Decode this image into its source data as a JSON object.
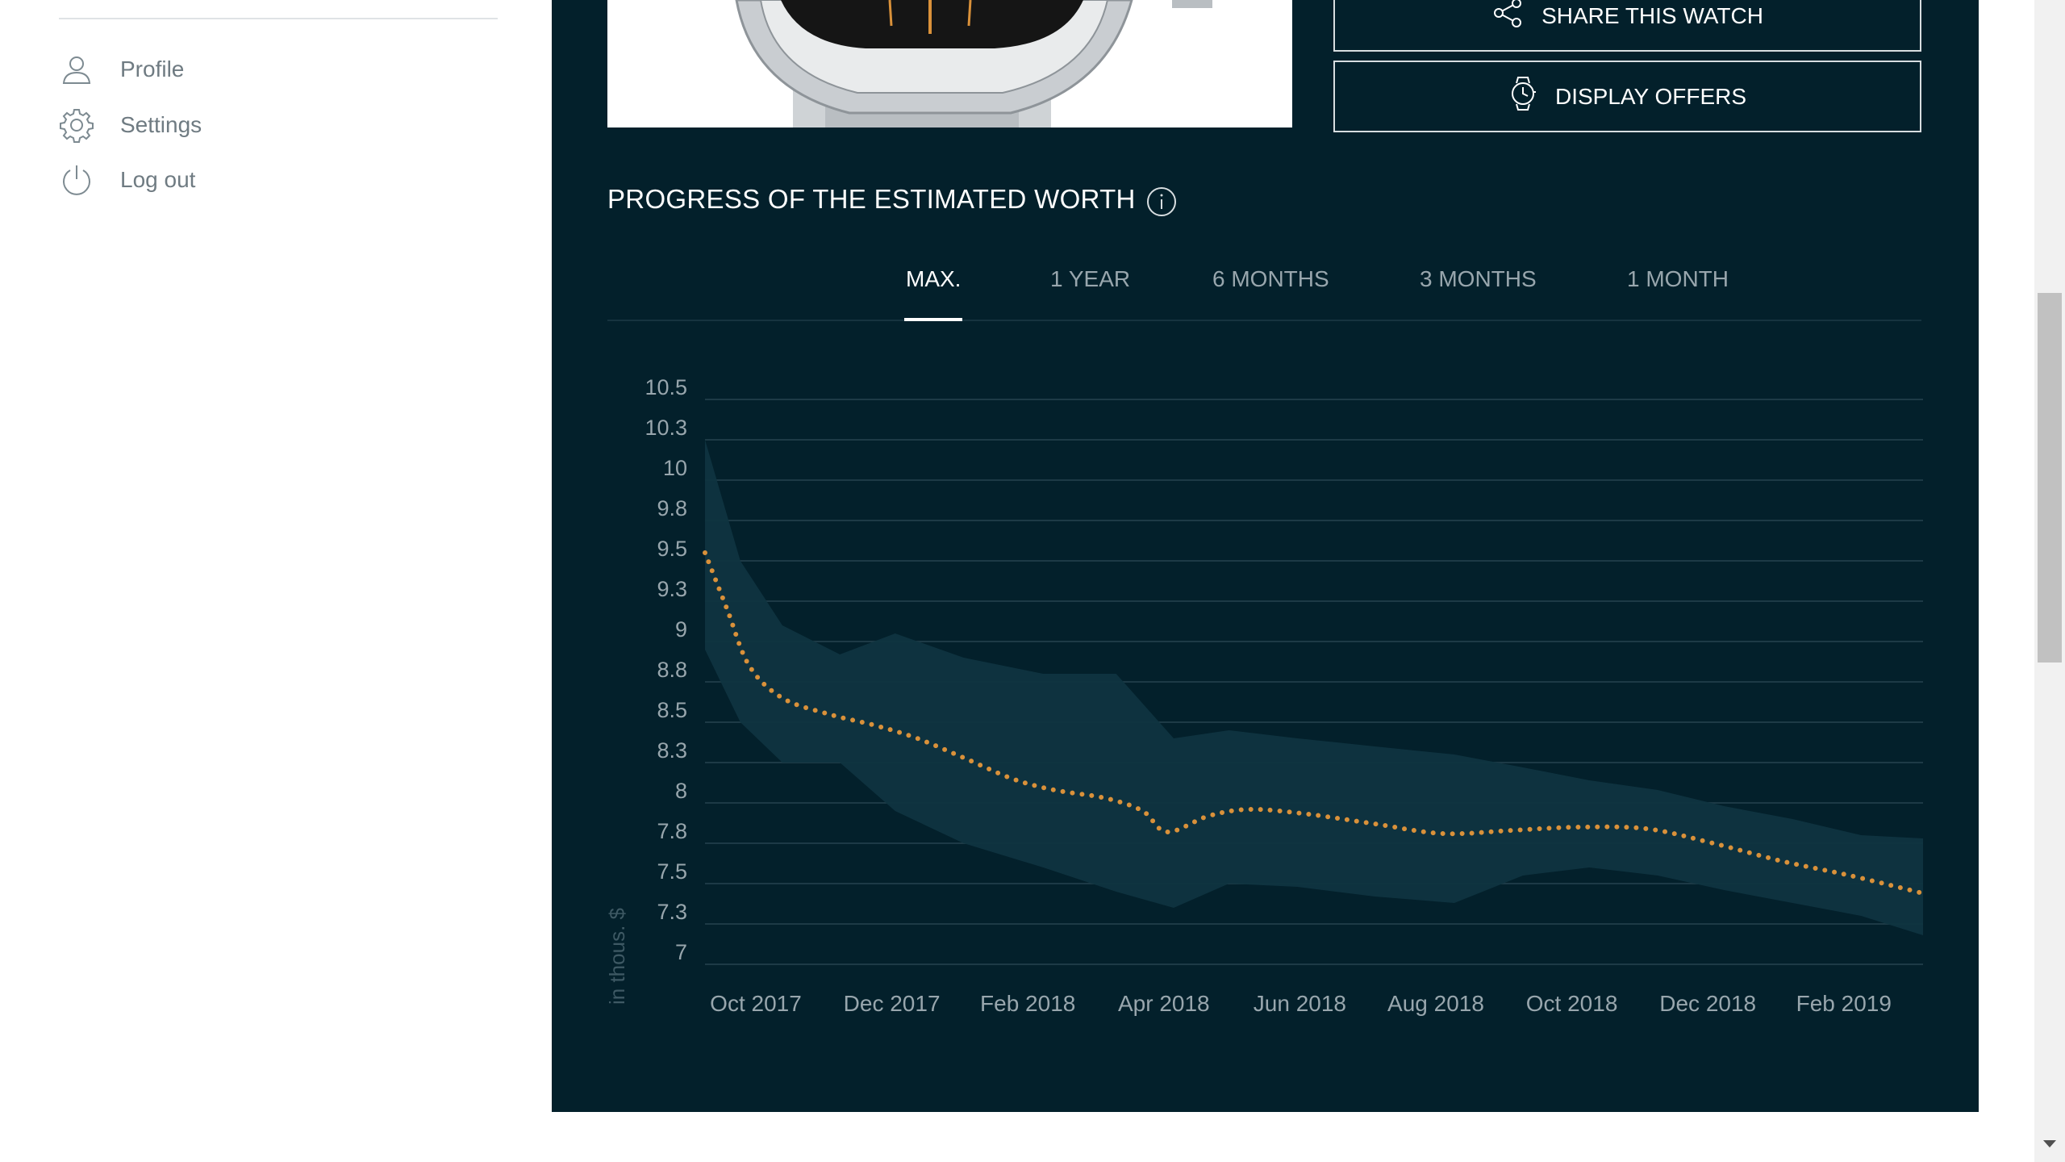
{
  "sidebar": {
    "items": [
      {
        "label": "Profile",
        "icon": "user-icon"
      },
      {
        "label": "Settings",
        "icon": "gear-icon"
      },
      {
        "label": "Log out",
        "icon": "power-icon"
      }
    ]
  },
  "actions": {
    "share_label": "SHARE THIS WATCH",
    "offers_label": "DISPLAY OFFERS"
  },
  "section": {
    "title": "PROGRESS OF THE ESTIMATED WORTH"
  },
  "tabs": [
    {
      "label": "MAX.",
      "active": true
    },
    {
      "label": "1 YEAR",
      "active": false
    },
    {
      "label": "6 MONTHS",
      "active": false
    },
    {
      "label": "3 MONTHS",
      "active": false
    },
    {
      "label": "1 MONTH",
      "active": false
    }
  ],
  "colors": {
    "panel": "#03202b",
    "line": "#d9913a",
    "band": "#0f3440",
    "grid": "#1d3a46"
  },
  "chart_data": {
    "type": "area",
    "ylabel": "in thous. $",
    "y_ticks": [
      "10.5",
      "10.3",
      "10",
      "9.8",
      "9.5",
      "9.3",
      "9",
      "8.8",
      "8.5",
      "8.3",
      "8",
      "7.8",
      "7.5",
      "7.3",
      "7"
    ],
    "ylim": [
      7,
      10.5
    ],
    "x_ticks": [
      "Oct 2017",
      "Dec 2017",
      "Feb 2018",
      "Apr 2018",
      "Jun 2018",
      "Aug 2018",
      "Oct 2018",
      "Dec 2018",
      "Feb 2019"
    ],
    "xlim": [
      "2017-09-15",
      "2019-03-20"
    ],
    "grid": true,
    "series": [
      {
        "x": [
          "2017-09-15",
          "2017-09-25",
          "2017-10-05",
          "2017-10-20",
          "2017-11-10",
          "2017-12-01",
          "2017-12-20",
          "2018-01-10",
          "2018-02-01",
          "2018-02-20",
          "2018-03-15",
          "2018-04-01",
          "2018-04-12",
          "2018-05-01",
          "2018-05-20",
          "2018-06-15",
          "2018-07-15",
          "2018-08-15",
          "2018-09-15",
          "2018-10-15",
          "2018-11-15",
          "2018-12-15",
          "2019-01-15",
          "2019-02-15",
          "2019-03-20"
        ],
        "values": [
          9.55,
          9.2,
          8.85,
          8.65,
          8.55,
          8.48,
          8.4,
          8.28,
          8.15,
          8.08,
          8.03,
          7.95,
          7.82,
          7.92,
          7.96,
          7.93,
          7.87,
          7.81,
          7.83,
          7.85,
          7.84,
          7.75,
          7.64,
          7.55,
          7.44
        ]
      }
    ],
    "band": {
      "x": [
        "2017-09-15",
        "2017-10-01",
        "2017-10-20",
        "2017-11-15",
        "2017-12-10",
        "2018-01-10",
        "2018-02-15",
        "2018-03-20",
        "2018-04-15",
        "2018-05-10",
        "2018-06-10",
        "2018-07-15",
        "2018-08-20",
        "2018-09-20",
        "2018-10-20",
        "2018-11-20",
        "2018-12-20",
        "2019-01-20",
        "2019-02-20",
        "2019-03-20"
      ],
      "upper": [
        10.25,
        9.5,
        9.1,
        8.92,
        9.05,
        8.9,
        8.8,
        8.8,
        8.4,
        8.45,
        8.4,
        8.35,
        8.3,
        8.22,
        8.14,
        8.08,
        7.98,
        7.9,
        7.8,
        7.78
      ],
      "lower": [
        8.95,
        8.5,
        8.25,
        8.25,
        7.95,
        7.75,
        7.6,
        7.45,
        7.35,
        7.5,
        7.48,
        7.42,
        7.38,
        7.55,
        7.6,
        7.55,
        7.46,
        7.38,
        7.3,
        7.18
      ]
    }
  }
}
